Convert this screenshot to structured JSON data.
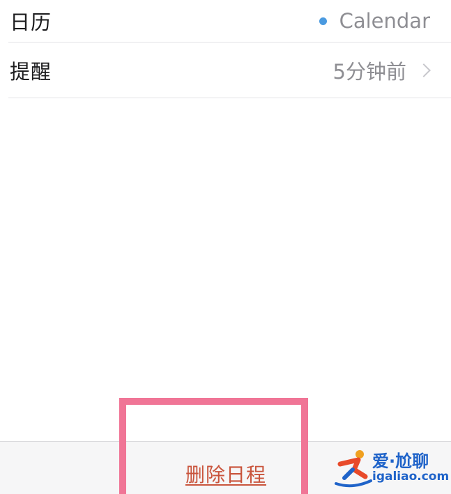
{
  "settings": {
    "calendar": {
      "label": "日历",
      "value": "Calendar",
      "dot_color": "#4a9ae0"
    },
    "alert": {
      "label": "提醒",
      "value": "5分钟前"
    }
  },
  "actions": {
    "delete_label": "删除日程",
    "delete_color": "#c9543c"
  },
  "annotation": {
    "highlight_color": "#f07596"
  },
  "watermark": {
    "line1": "爱·尬聊",
    "line2": "igaliao.com"
  }
}
